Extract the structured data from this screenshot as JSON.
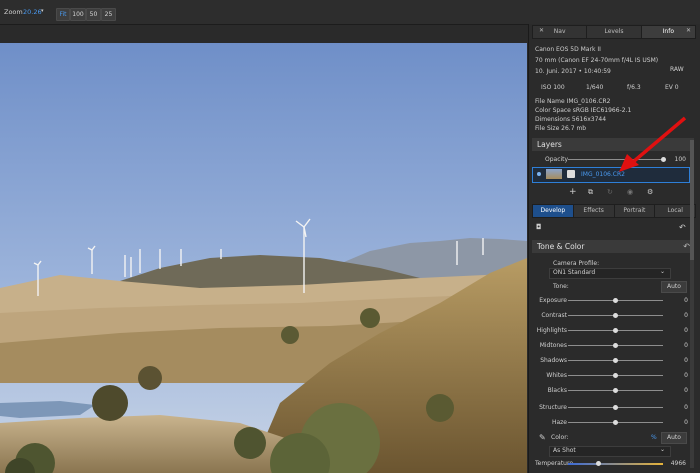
{
  "toolbar": {
    "zoom_label": "Zoom",
    "zoom_value": "20.26",
    "buttons": [
      "Fit",
      "100",
      "50",
      "25"
    ]
  },
  "panel": {
    "top_tabs": [
      "Nav",
      "Levels",
      "Info"
    ],
    "info": {
      "camera": "Canon EOS 5D Mark II",
      "lens": "70 mm (Canon EF 24-70mm f/4L IS USM)",
      "date": "10. Juni. 2017 • 10:40:59",
      "format": "RAW",
      "iso": "ISO 100",
      "shutter": "1/640",
      "aperture": "f/6.3",
      "ev": "EV 0",
      "file_name": "File Name   IMG_0106.CR2",
      "color_space": "Color Space sRGB IEC61966-2.1",
      "dimensions": "Dimensions 5616x3744",
      "file_size": "File Size     26.7 mb"
    },
    "layers": {
      "title": "Layers",
      "opacity_label": "Opacity",
      "opacity_value": "100",
      "layer_name": "IMG_0106.CR2"
    },
    "module_tabs": [
      "Develop",
      "Effects",
      "Portrait",
      "Local"
    ],
    "tone_color": {
      "title": "Tone & Color",
      "camera_profile_label": "Camera Profile:",
      "camera_profile_value": "ON1 Standard",
      "tone_label": "Tone:",
      "auto_label": "Auto",
      "sliders": [
        {
          "label": "Exposure",
          "value": "0"
        },
        {
          "label": "Contrast",
          "value": "0"
        },
        {
          "label": "Highlights",
          "value": "0"
        },
        {
          "label": "Midtones",
          "value": "0"
        },
        {
          "label": "Shadows",
          "value": "0"
        },
        {
          "label": "Whites",
          "value": "0"
        },
        {
          "label": "Blacks",
          "value": "0"
        },
        {
          "label": "Structure",
          "value": "0"
        },
        {
          "label": "Haze",
          "value": "0"
        }
      ],
      "color_label": "Color:",
      "color_auto": "Auto",
      "color_mode": "As Shot",
      "temperature_label": "Temperature",
      "temperature_value": "4966"
    }
  },
  "colors": {
    "accent": "#2e7fd8",
    "arrow": "#e01010",
    "panel": "#2b2b2b"
  }
}
